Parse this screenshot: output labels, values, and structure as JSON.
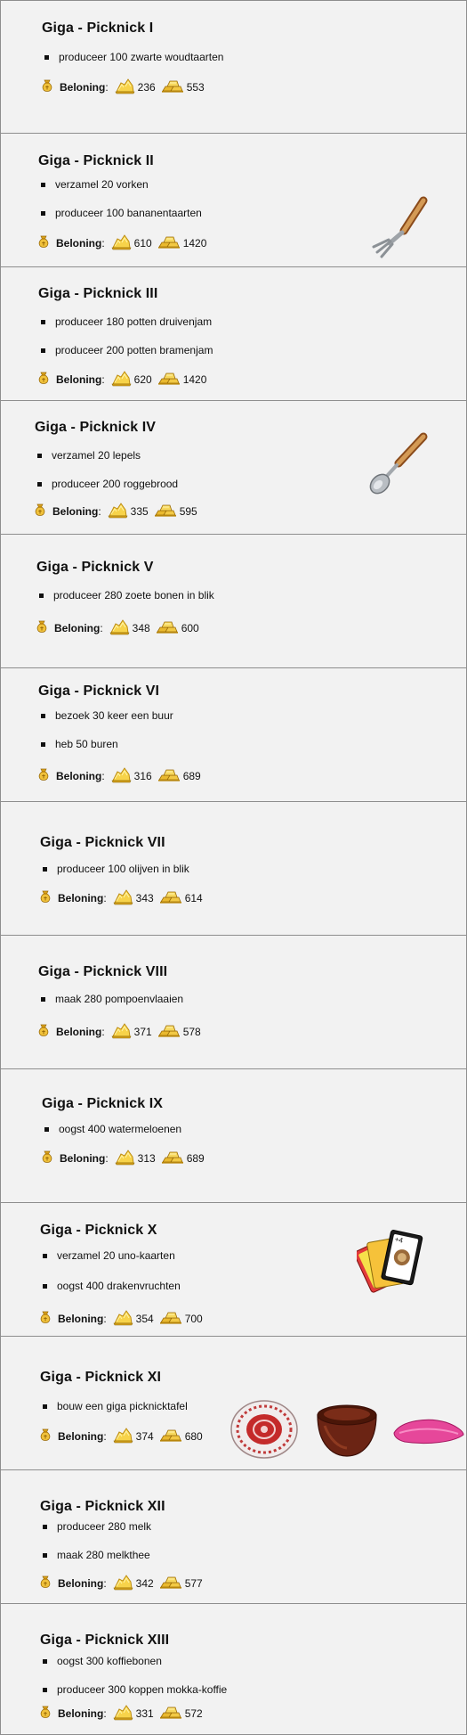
{
  "reward_label": "Beloning",
  "quests": [
    {
      "title": "Giga - Picknick I",
      "tasks": [
        "produceer 100 zwarte woudtaarten"
      ],
      "coins": "236",
      "xp": "553",
      "items": []
    },
    {
      "title": "Giga - Picknick II",
      "tasks": [
        "verzamel 20 vorken",
        "produceer 100 bananentaarten"
      ],
      "coins": "610",
      "xp": "1420",
      "items": [
        "fork-icon"
      ]
    },
    {
      "title": "Giga - Picknick III",
      "tasks": [
        "produceer 180 potten druivenjam",
        "produceer 200 potten bramenjam"
      ],
      "coins": "620",
      "xp": "1420",
      "items": []
    },
    {
      "title": "Giga - Picknick IV",
      "tasks": [
        "verzamel 20 lepels",
        "produceer 200 roggebrood"
      ],
      "coins": "335",
      "xp": "595",
      "items": [
        "spoon-icon"
      ]
    },
    {
      "title": "Giga - Picknick V",
      "tasks": [
        "produceer 280 zoete bonen in blik"
      ],
      "coins": "348",
      "xp": "600",
      "items": []
    },
    {
      "title": "Giga - Picknick VI",
      "tasks": [
        "bezoek 30 keer een buur",
        "heb 50 buren"
      ],
      "coins": "316",
      "xp": "689",
      "items": []
    },
    {
      "title": "Giga - Picknick VII",
      "tasks": [
        "produceer 100 olijven in blik"
      ],
      "coins": "343",
      "xp": "614",
      "items": []
    },
    {
      "title": "Giga - Picknick VIII",
      "tasks": [
        "maak 280 pompoenvlaaien"
      ],
      "coins": "371",
      "xp": "578",
      "items": []
    },
    {
      "title": "Giga - Picknick IX",
      "tasks": [
        "oogst 400 watermeloenen"
      ],
      "coins": "313",
      "xp": "689",
      "items": []
    },
    {
      "title": "Giga - Picknick X",
      "tasks": [
        "verzamel 20 uno-kaarten",
        "oogst  400 drakenvruchten"
      ],
      "coins": "354",
      "xp": "700",
      "items": [
        "uno-cards-icon"
      ]
    },
    {
      "title": "Giga - Picknick XI",
      "tasks": [
        "bouw een giga picknicktafel"
      ],
      "coins": "374",
      "xp": "680",
      "items": [
        "plate-icon",
        "bowl-icon",
        "napkin-icon"
      ]
    },
    {
      "title": "Giga - Picknick XII",
      "tasks": [
        "produceer 280 melk",
        "maak 280 melkthee"
      ],
      "coins": "342",
      "xp": "577",
      "items": []
    },
    {
      "title": "Giga - Picknick XIII",
      "tasks": [
        "oogst 300 koffiebonen",
        "produceer 300 koppen mokka-koffie"
      ],
      "coins": "331",
      "xp": "572",
      "items": []
    }
  ]
}
